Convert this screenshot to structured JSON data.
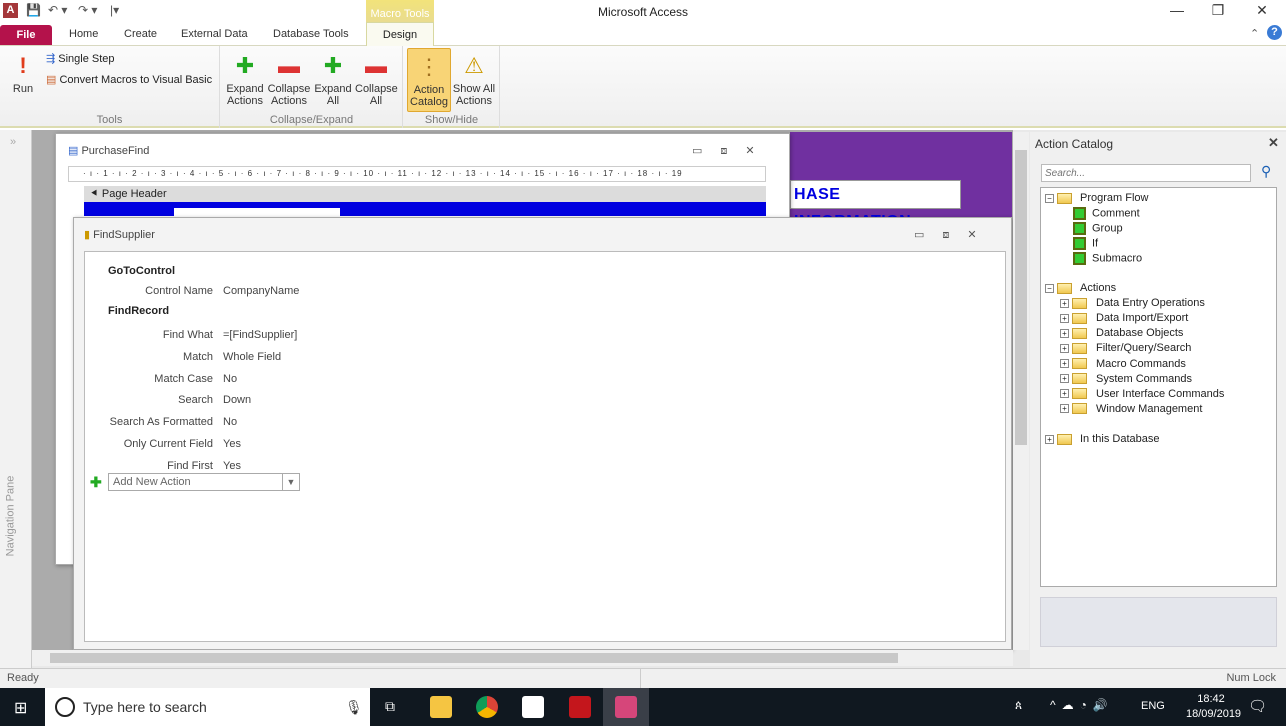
{
  "window": {
    "title": "Microsoft Access",
    "contextual_tab": "Macro Tools"
  },
  "tabs": [
    "File",
    "Home",
    "Create",
    "External Data",
    "Database Tools",
    "Design"
  ],
  "ribbon": {
    "tools": {
      "run": "Run",
      "single_step": "Single Step",
      "convert": "Convert Macros to Visual Basic",
      "label": "Tools"
    },
    "collapse_expand": {
      "buttons": [
        [
          "Expand",
          "Actions"
        ],
        [
          "Collapse",
          "Actions"
        ],
        [
          "Expand",
          "All"
        ],
        [
          "Collapse",
          "All"
        ]
      ],
      "label": "Collapse/Expand"
    },
    "show_hide": {
      "buttons": [
        [
          "Action",
          "Catalog"
        ],
        [
          "Show All",
          "Actions"
        ]
      ],
      "label": "Show/Hide"
    }
  },
  "nav_pane": {
    "label": "Navigation Pane",
    "toggle": "»"
  },
  "purchase_find": {
    "title": "PurchaseFind",
    "ruler": "· ı · 1 · ı · 2 · ı · 3 · ı · 4 · ı · 5 · ı · 6 · ı · 7 · ı · 8 · ı · 9 · ı · 10 · ı · 11 · ı · 12 · ı · 13 · ı · 14 · ı · 15 · ı · 16 · ı · 17 · ı · 18 · ı · 19",
    "section": "Page Header",
    "banner": "HASE INFORMATION"
  },
  "find_supplier": {
    "title": "FindSupplier",
    "actions": [
      {
        "name": "GoToControl",
        "args": [
          {
            "label": "Control Name",
            "value": "CompanyName"
          }
        ]
      },
      {
        "name": "FindRecord",
        "args": [
          {
            "label": "Find What",
            "value": "=[FindSupplier]"
          },
          {
            "label": "Match",
            "value": "Whole Field"
          },
          {
            "label": "Match Case",
            "value": "No"
          },
          {
            "label": "Search",
            "value": "Down"
          },
          {
            "label": "Search As Formatted",
            "value": "No"
          },
          {
            "label": "Only Current Field",
            "value": "Yes"
          },
          {
            "label": "Find First",
            "value": "Yes"
          }
        ]
      }
    ],
    "add_new_action": "Add New Action"
  },
  "catalog": {
    "title": "Action Catalog",
    "search_placeholder": "Search...",
    "program_flow": {
      "label": "Program Flow",
      "items": [
        "Comment",
        "Group",
        "If",
        "Submacro"
      ]
    },
    "actions": {
      "label": "Actions",
      "items": [
        "Data Entry Operations",
        "Data Import/Export",
        "Database Objects",
        "Filter/Query/Search",
        "Macro Commands",
        "System Commands",
        "User Interface Commands",
        "Window Management"
      ]
    },
    "in_db": "In this Database"
  },
  "status": {
    "left": "Ready",
    "right": "Num Lock"
  },
  "taskbar": {
    "search": "Type here to search",
    "time": "18:42",
    "date": "18/09/2019",
    "lang": "ENG"
  }
}
